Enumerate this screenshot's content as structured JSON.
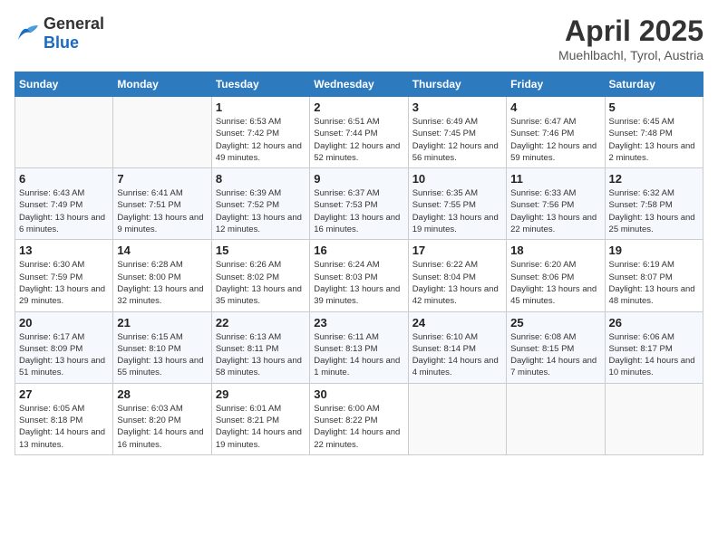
{
  "logo": {
    "general": "General",
    "blue": "Blue"
  },
  "header": {
    "title": "April 2025",
    "subtitle": "Muehlbachl, Tyrol, Austria"
  },
  "weekdays": [
    "Sunday",
    "Monday",
    "Tuesday",
    "Wednesday",
    "Thursday",
    "Friday",
    "Saturday"
  ],
  "weeks": [
    [
      {
        "day": null
      },
      {
        "day": null
      },
      {
        "day": "1",
        "sunrise": "Sunrise: 6:53 AM",
        "sunset": "Sunset: 7:42 PM",
        "daylight": "Daylight: 12 hours and 49 minutes."
      },
      {
        "day": "2",
        "sunrise": "Sunrise: 6:51 AM",
        "sunset": "Sunset: 7:44 PM",
        "daylight": "Daylight: 12 hours and 52 minutes."
      },
      {
        "day": "3",
        "sunrise": "Sunrise: 6:49 AM",
        "sunset": "Sunset: 7:45 PM",
        "daylight": "Daylight: 12 hours and 56 minutes."
      },
      {
        "day": "4",
        "sunrise": "Sunrise: 6:47 AM",
        "sunset": "Sunset: 7:46 PM",
        "daylight": "Daylight: 12 hours and 59 minutes."
      },
      {
        "day": "5",
        "sunrise": "Sunrise: 6:45 AM",
        "sunset": "Sunset: 7:48 PM",
        "daylight": "Daylight: 13 hours and 2 minutes."
      }
    ],
    [
      {
        "day": "6",
        "sunrise": "Sunrise: 6:43 AM",
        "sunset": "Sunset: 7:49 PM",
        "daylight": "Daylight: 13 hours and 6 minutes."
      },
      {
        "day": "7",
        "sunrise": "Sunrise: 6:41 AM",
        "sunset": "Sunset: 7:51 PM",
        "daylight": "Daylight: 13 hours and 9 minutes."
      },
      {
        "day": "8",
        "sunrise": "Sunrise: 6:39 AM",
        "sunset": "Sunset: 7:52 PM",
        "daylight": "Daylight: 13 hours and 12 minutes."
      },
      {
        "day": "9",
        "sunrise": "Sunrise: 6:37 AM",
        "sunset": "Sunset: 7:53 PM",
        "daylight": "Daylight: 13 hours and 16 minutes."
      },
      {
        "day": "10",
        "sunrise": "Sunrise: 6:35 AM",
        "sunset": "Sunset: 7:55 PM",
        "daylight": "Daylight: 13 hours and 19 minutes."
      },
      {
        "day": "11",
        "sunrise": "Sunrise: 6:33 AM",
        "sunset": "Sunset: 7:56 PM",
        "daylight": "Daylight: 13 hours and 22 minutes."
      },
      {
        "day": "12",
        "sunrise": "Sunrise: 6:32 AM",
        "sunset": "Sunset: 7:58 PM",
        "daylight": "Daylight: 13 hours and 25 minutes."
      }
    ],
    [
      {
        "day": "13",
        "sunrise": "Sunrise: 6:30 AM",
        "sunset": "Sunset: 7:59 PM",
        "daylight": "Daylight: 13 hours and 29 minutes."
      },
      {
        "day": "14",
        "sunrise": "Sunrise: 6:28 AM",
        "sunset": "Sunset: 8:00 PM",
        "daylight": "Daylight: 13 hours and 32 minutes."
      },
      {
        "day": "15",
        "sunrise": "Sunrise: 6:26 AM",
        "sunset": "Sunset: 8:02 PM",
        "daylight": "Daylight: 13 hours and 35 minutes."
      },
      {
        "day": "16",
        "sunrise": "Sunrise: 6:24 AM",
        "sunset": "Sunset: 8:03 PM",
        "daylight": "Daylight: 13 hours and 39 minutes."
      },
      {
        "day": "17",
        "sunrise": "Sunrise: 6:22 AM",
        "sunset": "Sunset: 8:04 PM",
        "daylight": "Daylight: 13 hours and 42 minutes."
      },
      {
        "day": "18",
        "sunrise": "Sunrise: 6:20 AM",
        "sunset": "Sunset: 8:06 PM",
        "daylight": "Daylight: 13 hours and 45 minutes."
      },
      {
        "day": "19",
        "sunrise": "Sunrise: 6:19 AM",
        "sunset": "Sunset: 8:07 PM",
        "daylight": "Daylight: 13 hours and 48 minutes."
      }
    ],
    [
      {
        "day": "20",
        "sunrise": "Sunrise: 6:17 AM",
        "sunset": "Sunset: 8:09 PM",
        "daylight": "Daylight: 13 hours and 51 minutes."
      },
      {
        "day": "21",
        "sunrise": "Sunrise: 6:15 AM",
        "sunset": "Sunset: 8:10 PM",
        "daylight": "Daylight: 13 hours and 55 minutes."
      },
      {
        "day": "22",
        "sunrise": "Sunrise: 6:13 AM",
        "sunset": "Sunset: 8:11 PM",
        "daylight": "Daylight: 13 hours and 58 minutes."
      },
      {
        "day": "23",
        "sunrise": "Sunrise: 6:11 AM",
        "sunset": "Sunset: 8:13 PM",
        "daylight": "Daylight: 14 hours and 1 minute."
      },
      {
        "day": "24",
        "sunrise": "Sunrise: 6:10 AM",
        "sunset": "Sunset: 8:14 PM",
        "daylight": "Daylight: 14 hours and 4 minutes."
      },
      {
        "day": "25",
        "sunrise": "Sunrise: 6:08 AM",
        "sunset": "Sunset: 8:15 PM",
        "daylight": "Daylight: 14 hours and 7 minutes."
      },
      {
        "day": "26",
        "sunrise": "Sunrise: 6:06 AM",
        "sunset": "Sunset: 8:17 PM",
        "daylight": "Daylight: 14 hours and 10 minutes."
      }
    ],
    [
      {
        "day": "27",
        "sunrise": "Sunrise: 6:05 AM",
        "sunset": "Sunset: 8:18 PM",
        "daylight": "Daylight: 14 hours and 13 minutes."
      },
      {
        "day": "28",
        "sunrise": "Sunrise: 6:03 AM",
        "sunset": "Sunset: 8:20 PM",
        "daylight": "Daylight: 14 hours and 16 minutes."
      },
      {
        "day": "29",
        "sunrise": "Sunrise: 6:01 AM",
        "sunset": "Sunset: 8:21 PM",
        "daylight": "Daylight: 14 hours and 19 minutes."
      },
      {
        "day": "30",
        "sunrise": "Sunrise: 6:00 AM",
        "sunset": "Sunset: 8:22 PM",
        "daylight": "Daylight: 14 hours and 22 minutes."
      },
      {
        "day": null
      },
      {
        "day": null
      },
      {
        "day": null
      }
    ]
  ]
}
